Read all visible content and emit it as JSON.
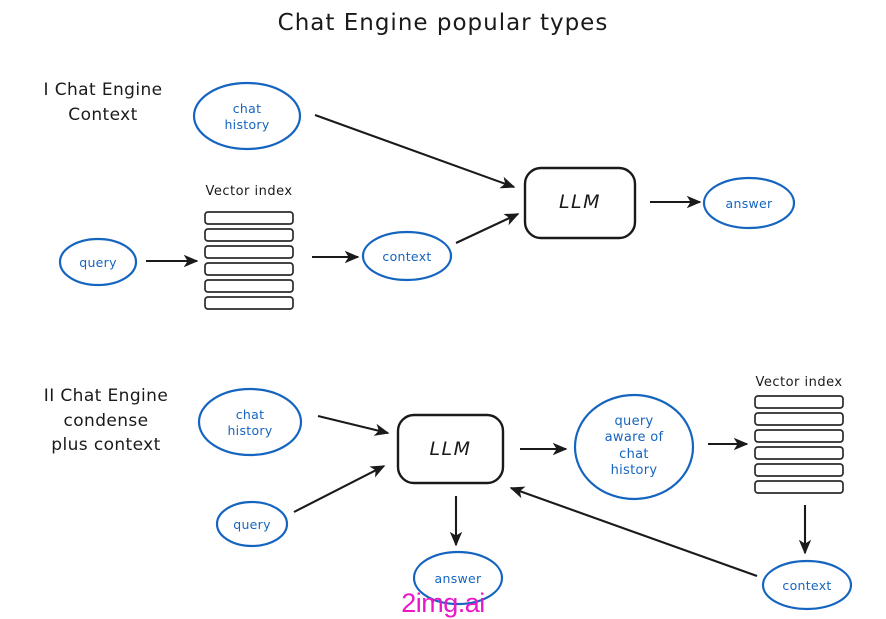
{
  "title": "Chat Engine popular types",
  "watermark": "2img.ai",
  "colors": {
    "node_stroke": "#1565c0",
    "node_text": "#1565c0",
    "ink": "#1a1a1a",
    "watermark": "#ea18c6",
    "background": "#ffffff"
  },
  "sections": [
    {
      "id": "section-1",
      "label_lines": [
        "I Chat Engine",
        "Context"
      ],
      "nodes": [
        {
          "id": "chat-history",
          "label_lines": [
            "chat",
            "history"
          ],
          "shape": "ellipse"
        },
        {
          "id": "query",
          "label_lines": [
            "query"
          ],
          "shape": "ellipse"
        },
        {
          "id": "context",
          "label_lines": [
            "context"
          ],
          "shape": "ellipse"
        },
        {
          "id": "llm",
          "label_lines": [
            "LLM"
          ],
          "shape": "rounded-rect"
        },
        {
          "id": "answer",
          "label_lines": [
            "answer"
          ],
          "shape": "ellipse"
        },
        {
          "id": "vector-index",
          "label_lines": [
            "Vector index"
          ],
          "shape": "stack",
          "rows": 6
        }
      ],
      "edges": [
        {
          "from": "chat-history",
          "to": "llm"
        },
        {
          "from": "query",
          "to": "vector-index"
        },
        {
          "from": "vector-index",
          "to": "context"
        },
        {
          "from": "context",
          "to": "llm"
        },
        {
          "from": "llm",
          "to": "answer"
        }
      ]
    },
    {
      "id": "section-2",
      "label_lines": [
        "II Chat Engine",
        "condense",
        "plus context"
      ],
      "nodes": [
        {
          "id": "chat-history-2",
          "label_lines": [
            "chat",
            "history"
          ],
          "shape": "ellipse"
        },
        {
          "id": "query-2",
          "label_lines": [
            "query"
          ],
          "shape": "ellipse"
        },
        {
          "id": "llm-2",
          "label_lines": [
            "LLM"
          ],
          "shape": "rounded-rect"
        },
        {
          "id": "query-aware",
          "label_lines": [
            "query",
            "aware of",
            "chat",
            "history"
          ],
          "shape": "ellipse"
        },
        {
          "id": "vector-index-2",
          "label_lines": [
            "Vector index"
          ],
          "shape": "stack",
          "rows": 6
        },
        {
          "id": "answer-2",
          "label_lines": [
            "answer"
          ],
          "shape": "ellipse"
        },
        {
          "id": "context-2",
          "label_lines": [
            "context"
          ],
          "shape": "ellipse"
        }
      ],
      "edges": [
        {
          "from": "chat-history-2",
          "to": "llm-2"
        },
        {
          "from": "query-2",
          "to": "llm-2"
        },
        {
          "from": "llm-2",
          "to": "query-aware"
        },
        {
          "from": "query-aware",
          "to": "vector-index-2"
        },
        {
          "from": "vector-index-2",
          "to": "context-2"
        },
        {
          "from": "context-2",
          "to": "llm-2"
        },
        {
          "from": "llm-2",
          "to": "answer-2"
        }
      ]
    }
  ],
  "labels": {
    "section1": {
      "line1": "I Chat Engine",
      "line2": "Context",
      "chat_history_1": "chat",
      "chat_history_2": "history",
      "query": "query",
      "vector_index": "Vector index",
      "context": "context",
      "llm": "LLM",
      "answer": "answer"
    },
    "section2": {
      "line1": "II Chat Engine",
      "line2": "condense",
      "line3": "plus context",
      "chat_history_1": "chat",
      "chat_history_2": "history",
      "query": "query",
      "llm": "LLM",
      "query_aware_1": "query",
      "query_aware_2": "aware of",
      "query_aware_3": "chat",
      "query_aware_4": "history",
      "vector_index": "Vector index",
      "answer": "answer",
      "context": "context"
    }
  }
}
